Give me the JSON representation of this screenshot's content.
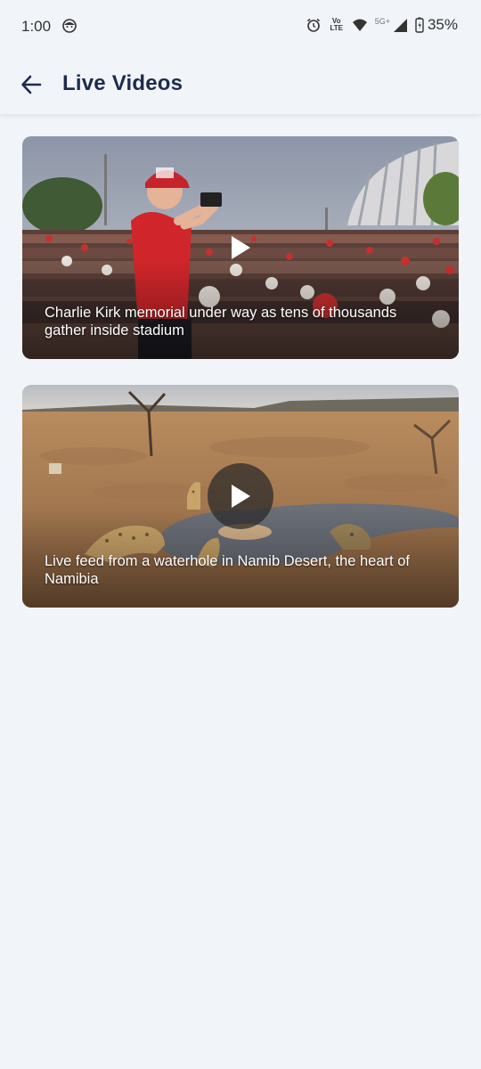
{
  "status_bar": {
    "time": "1:00",
    "network_label": "5G+",
    "volte_label": "Vo",
    "lte_label": "LTE",
    "battery": "35%",
    "icons": [
      "face-icon",
      "alarm-icon",
      "volte-icon",
      "wifi-icon",
      "signal-icon",
      "battery-icon"
    ]
  },
  "app_bar": {
    "title": "Live Videos",
    "back_icon": "arrow-left-icon"
  },
  "videos": [
    {
      "caption": "Charlie Kirk memorial under way as tens of thousands gather inside stadium",
      "thumbnail": "stadium-crowd"
    },
    {
      "caption": "Live feed from a waterhole in Namib Desert, the heart of Namibia",
      "thumbnail": "desert-waterhole"
    }
  ],
  "colors": {
    "background": "#f1f4f9",
    "title": "#1d2b4c",
    "caption": "#ffffff"
  }
}
